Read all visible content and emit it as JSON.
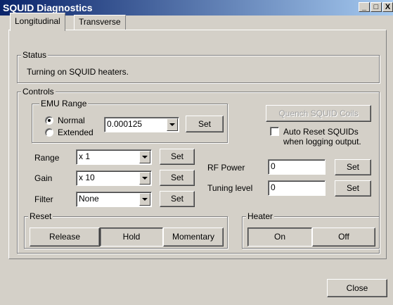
{
  "window": {
    "title": "SQUID Diagnostics",
    "minimize": "_",
    "maximize": "□",
    "close": "X"
  },
  "tabs": [
    {
      "label": "Longitudinal",
      "active": true
    },
    {
      "label": "Transverse",
      "active": false
    }
  ],
  "status": {
    "legend": "Status",
    "text": "Turning on SQUID heaters."
  },
  "controls": {
    "legend": "Controls",
    "emu": {
      "legend": "EMU Range",
      "normal_label": "Normal",
      "extended_label": "Extended",
      "selected": "Normal",
      "value": "0.000125",
      "set_label": "Set"
    },
    "quench_label": "Quench SQUID Coils",
    "auto_reset_line1": "Auto Reset SQUIDs",
    "auto_reset_line2": "when logging output.",
    "auto_reset_checked": false,
    "range": {
      "label": "Range",
      "value": "x 1",
      "set_label": "Set"
    },
    "gain": {
      "label": "Gain",
      "value": "x 10",
      "set_label": "Set"
    },
    "filter": {
      "label": "Filter",
      "value": "None",
      "set_label": "Set"
    },
    "rf_power": {
      "label": "RF Power",
      "value": "0",
      "set_label": "Set"
    },
    "tuning": {
      "label": "Tuning level",
      "value": "0",
      "set_label": "Set"
    },
    "reset": {
      "legend": "Reset",
      "release": "Release",
      "hold": "Hold",
      "momentary": "Momentary",
      "pressed": "Hold"
    },
    "heater": {
      "legend": "Heater",
      "on": "On",
      "off": "Off",
      "pressed": "On"
    }
  },
  "footer": {
    "close_label": "Close"
  }
}
